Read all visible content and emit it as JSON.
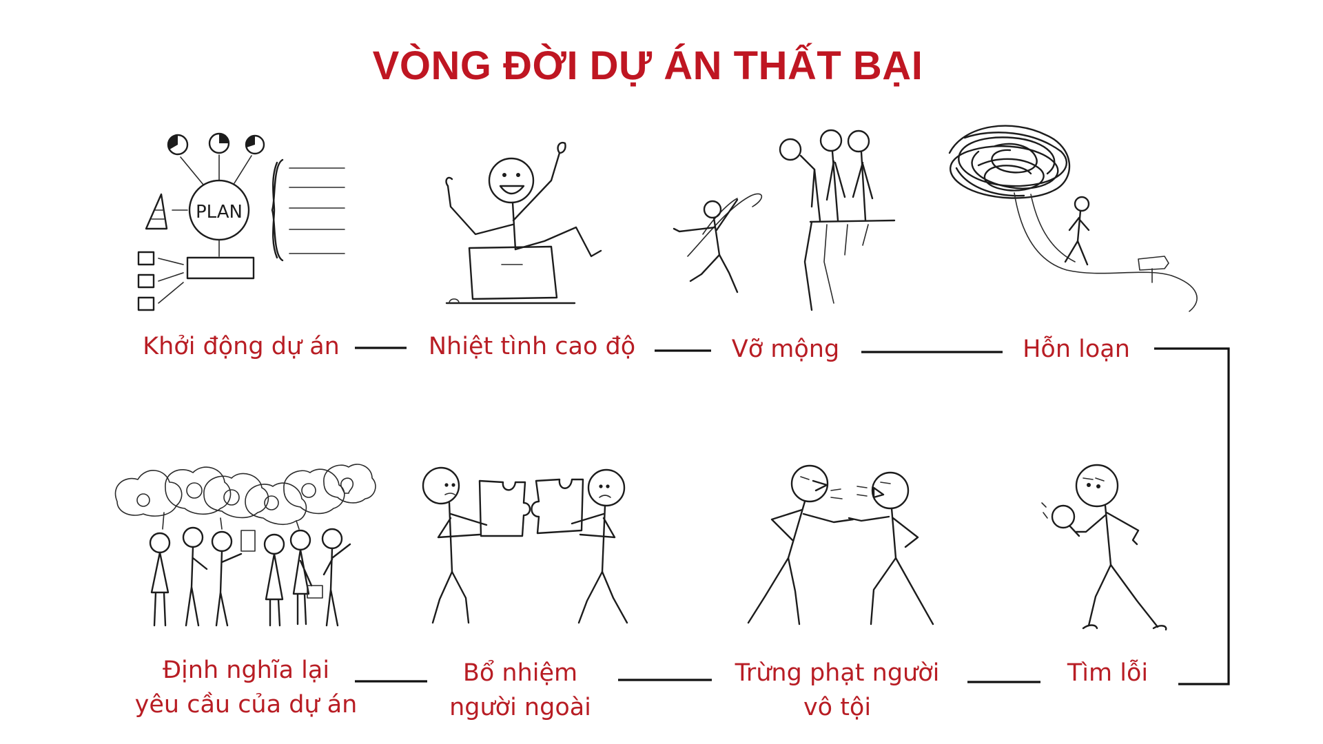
{
  "title": "VÒNG ĐỜI DỰ ÁN THẤT BẠI",
  "plan_text": "PLAN",
  "stages": [
    {
      "lines": [
        "Khởi động dự án"
      ]
    },
    {
      "lines": [
        "Nhiệt tình cao độ"
      ]
    },
    {
      "lines": [
        "Vỡ mộng"
      ]
    },
    {
      "lines": [
        "Hỗn loạn"
      ]
    },
    {
      "lines": [
        "Tìm lỗi"
      ]
    },
    {
      "lines": [
        "Trừng phạt người",
        "vô tội"
      ]
    },
    {
      "lines": [
        "Bổ nhiệm",
        "người ngoài"
      ]
    },
    {
      "lines": [
        "Định nghĩa lại",
        "yêu cầu của dự án"
      ]
    }
  ],
  "colors": {
    "title": "#bf1622",
    "label": "#b81d24",
    "ink": "#1c1c1c"
  }
}
